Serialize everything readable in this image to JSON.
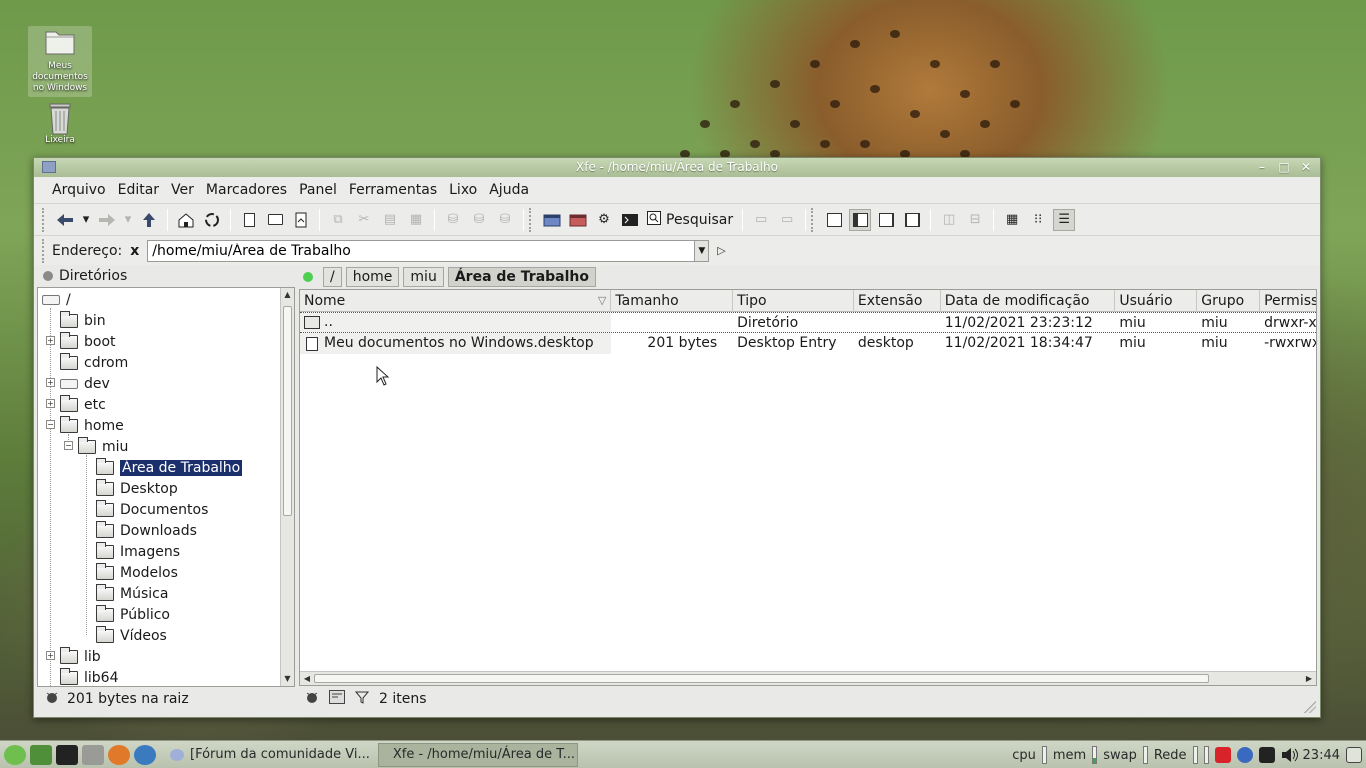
{
  "desktop": {
    "icons": [
      {
        "label": "Meus documentos no Windows"
      },
      {
        "label": "Lixeira"
      }
    ]
  },
  "window": {
    "title": "Xfe - /home/miu/Área de Trabalho",
    "buttons": {
      "minimize": "–",
      "maximize": "□",
      "close": "✕"
    }
  },
  "menu": [
    "Arquivo",
    "Editar",
    "Ver",
    "Marcadores",
    "Panel",
    "Ferramentas",
    "Lixo",
    "Ajuda"
  ],
  "toolbar": {
    "search_label": "Pesquisar"
  },
  "address": {
    "label": "Endereço:",
    "clear": "x",
    "value": "/home/miu/Área de Trabalho"
  },
  "tree": {
    "header": "Diretórios",
    "items": [
      {
        "label": "/"
      },
      {
        "label": "bin"
      },
      {
        "label": "boot"
      },
      {
        "label": "cdrom"
      },
      {
        "label": "dev"
      },
      {
        "label": "etc"
      },
      {
        "label": "home"
      },
      {
        "label": "miu"
      },
      {
        "label": "Área de Trabalho"
      },
      {
        "label": "Desktop"
      },
      {
        "label": "Documentos"
      },
      {
        "label": "Downloads"
      },
      {
        "label": "Imagens"
      },
      {
        "label": "Modelos"
      },
      {
        "label": "Música"
      },
      {
        "label": "Público"
      },
      {
        "label": "Vídeos"
      },
      {
        "label": "lib"
      },
      {
        "label": "lib64"
      }
    ],
    "status": "201 bytes na raiz"
  },
  "breadcrumbs": [
    "/",
    "home",
    "miu",
    "Área de Trabalho"
  ],
  "files": {
    "columns": [
      "Nome",
      "Tamanho",
      "Tipo",
      "Extensão",
      "Data de modificação",
      "Usuário",
      "Grupo",
      "Permiss"
    ],
    "rows": [
      {
        "name": "..",
        "size": "",
        "type": "Diretório",
        "ext": "",
        "date": "11/02/2021 23:23:12",
        "user": "miu",
        "group": "miu",
        "perm": "drwxr-xr"
      },
      {
        "name": "Meu documentos no Windows.desktop",
        "size": "201 bytes",
        "type": "Desktop Entry",
        "ext": "desktop",
        "date": "11/02/2021 18:34:47",
        "user": "miu",
        "group": "miu",
        "perm": "-rwxrwx"
      }
    ],
    "status": "2 itens"
  },
  "taskbar": {
    "tasks": [
      {
        "label": "[Fórum da comunidade Vi..."
      },
      {
        "label": "Xfe - /home/miu/Área de T..."
      }
    ],
    "tray": {
      "cpu": "cpu",
      "mem": "mem",
      "swap": "swap",
      "net": "Rede",
      "clock": "23:44"
    }
  },
  "colors": {
    "selection": "#1c2f6d",
    "titlebar": "#b8cba4",
    "status_dot_left": "#8a8a86",
    "status_dot_right": "#4fcf4f"
  }
}
